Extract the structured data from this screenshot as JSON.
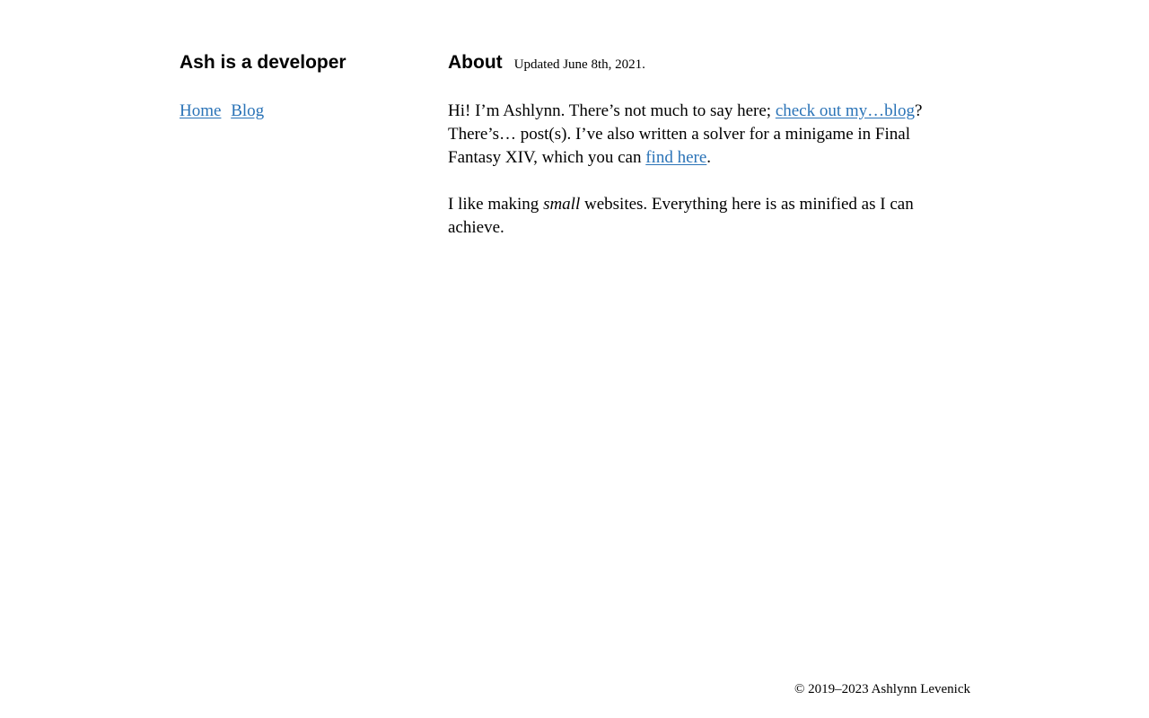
{
  "site": {
    "title": "Ash is a developer"
  },
  "nav": {
    "home_label": "Home",
    "blog_label": "Blog"
  },
  "about": {
    "title": "About",
    "updated": "Updated June 8th, 2021.",
    "para1": {
      "before_link": "Hi! I’m Ashlynn. There’s not much to say here; ",
      "link_text": "check out my…blog",
      "after_link": "? There’s… post(s). I’ve also written a solver for a minigame in Final Fantasy XIV, which you can ",
      "link2_text": "find here",
      "end": "."
    },
    "para2": {
      "before": "I like making ",
      "emphasis": "small",
      "after": " websites. Everything here is as minified as I can achieve."
    }
  },
  "footer": {
    "copyright": "© 2019–2023 Ashlynn Levenick"
  },
  "colors": {
    "link": "#2a73b7",
    "text": "#000000",
    "background": "#ffffff"
  }
}
